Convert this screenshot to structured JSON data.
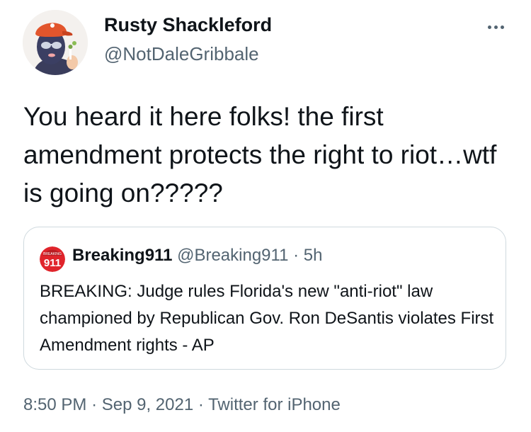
{
  "author": {
    "display_name": "Rusty Shackleford",
    "handle": "@NotDaleGribbale",
    "avatar_icon": "avatar-ski-mask-cartoon"
  },
  "more_icon": "more-horizontal-icon",
  "tweet": {
    "text": "You heard it here folks! the first amendment protects the right to riot…wtf is going on?????"
  },
  "quote": {
    "display_name": "Breaking911",
    "handle": "@Breaking911",
    "separator": "·",
    "time_ago": "5h",
    "avatar_text": "911",
    "avatar_subtext": "BREAKING",
    "text": "BREAKING: Judge rules Florida's new \"anti-riot\" law championed by Republican Gov. Ron DeSantis violates First Amendment rights - AP"
  },
  "meta": {
    "time": "8:50 PM",
    "separator": "·",
    "date": "Sep 9, 2021",
    "separator2": "·",
    "source": "Twitter for iPhone"
  },
  "colors": {
    "primary_text": "#0f1419",
    "secondary_text": "#536471",
    "border": "#cfd9de",
    "breaking_red": "#e0242b"
  }
}
